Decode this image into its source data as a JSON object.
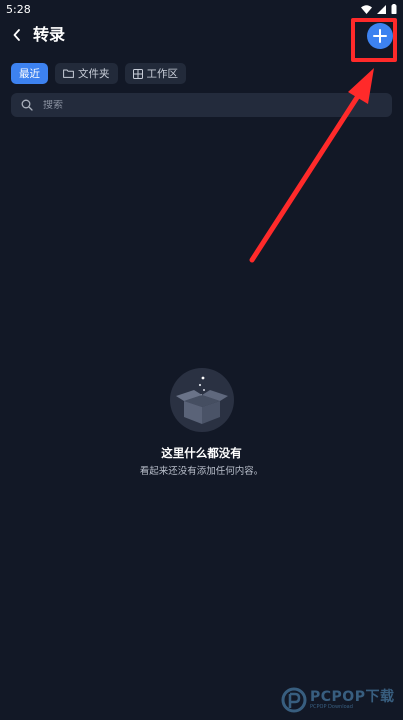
{
  "status_bar": {
    "time": "5:28",
    "icons": [
      "wifi-icon",
      "signal-icon",
      "battery-icon"
    ]
  },
  "header": {
    "title": "转录",
    "back_icon": "chevron-left-icon",
    "add_icon": "plus-icon"
  },
  "tabs": [
    {
      "label": "最近",
      "active": true,
      "icon": ""
    },
    {
      "label": "文件夹",
      "active": false,
      "icon": "folder-icon"
    },
    {
      "label": "工作区",
      "active": false,
      "icon": "grid-icon"
    }
  ],
  "search": {
    "placeholder": "搜索",
    "value": ""
  },
  "empty_state": {
    "title": "这里什么都没有",
    "subtitle": "看起来还没有添加任何内容。",
    "illustration": "empty-box-icon"
  },
  "watermark": {
    "text": "PCPOP下载",
    "subtext": "PCPOP Download"
  },
  "colors": {
    "background": "#121826",
    "accent": "#3d82f0",
    "annotation": "#ff2a2a"
  }
}
